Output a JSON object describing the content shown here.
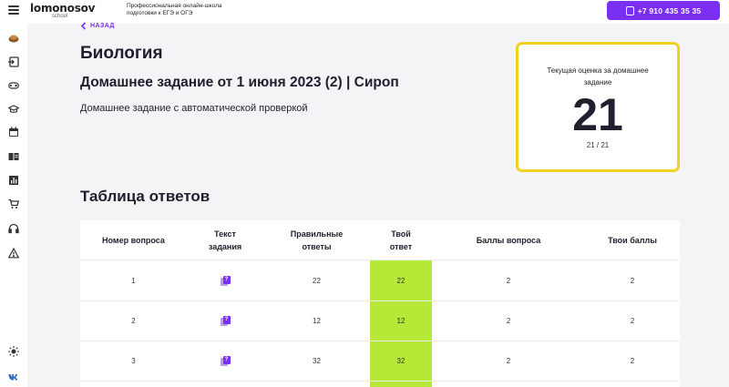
{
  "header": {
    "logo_main": "lomonosov",
    "logo_sub": "school",
    "tagline_line1": "Профессиональная онлайн-школа",
    "tagline_line2": "подготовки к ЕГЭ и ОГЭ",
    "phone": "+7 910 435 35 35",
    "accent_color": "#7b2ff2"
  },
  "sidebar": {
    "icons": [
      "menu-icon",
      "avatar-icon",
      "login-icon",
      "gamepad-icon",
      "graduation-cap-icon",
      "calendar-icon",
      "book-icon",
      "chart-icon",
      "cart-icon",
      "headset-icon",
      "warning-icon",
      "sun-icon",
      "vk-icon"
    ]
  },
  "page": {
    "back_label": "НАЗАД",
    "subject": "Биология",
    "homework_title": "Домашнее задание от 1 июня 2023 (2) | Сироп",
    "homework_desc": "Домашнее задание с автоматической проверкой"
  },
  "score": {
    "label": "Текущая оценка за домашнее задание",
    "value": "21",
    "fraction": "21 / 21",
    "border_color": "#f2d024"
  },
  "answers": {
    "title": "Таблица ответов",
    "columns": [
      "Номер вопроса",
      "Текст задания",
      "Правильные ответы",
      "Твой ответ",
      "Баллы вопроса",
      "Твои баллы"
    ],
    "rows": [
      {
        "num": "1",
        "correct": "22",
        "yours": "22",
        "points": "2",
        "your_points": "2"
      },
      {
        "num": "2",
        "correct": "12",
        "yours": "12",
        "points": "2",
        "your_points": "2"
      },
      {
        "num": "3",
        "correct": "32",
        "yours": "32",
        "points": "2",
        "your_points": "2"
      }
    ],
    "correct_color": "#b6e838"
  }
}
